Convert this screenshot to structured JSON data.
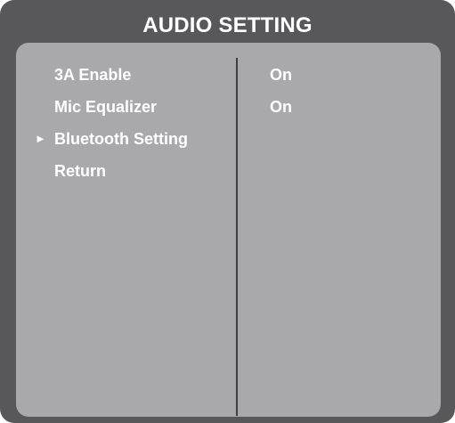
{
  "header": {
    "title": "AUDIO SETTING"
  },
  "menu": {
    "selected_marker": "►",
    "items": [
      {
        "label": "3A Enable",
        "value": "On",
        "selected": false
      },
      {
        "label": "Mic Equalizer",
        "value": "On",
        "selected": false
      },
      {
        "label": "Bluetooth Setting",
        "value": "",
        "selected": true
      },
      {
        "label": "Return",
        "value": "",
        "selected": false
      }
    ]
  },
  "colors": {
    "frame": "#58585a",
    "panel": "#a9a9ab",
    "text": "#ffffff",
    "divider": "#3f3f41"
  }
}
